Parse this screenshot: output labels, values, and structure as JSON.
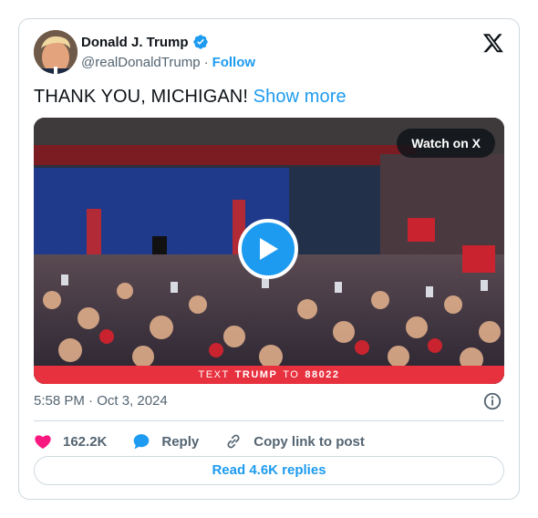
{
  "author": {
    "name": "Donald J. Trump",
    "handle": "@realDonaldTrump",
    "separator": "·",
    "follow_label": "Follow"
  },
  "tweet": {
    "text": "THANK YOU, MICHIGAN!",
    "show_more_label": "Show more"
  },
  "media": {
    "watch_label": "Watch on X",
    "banner_pre": "TEXT",
    "banner_bold": "TRUMP",
    "banner_mid": "TO",
    "banner_num": "88022"
  },
  "timestamp": "5:58 PM · Oct 3, 2024",
  "actions": {
    "likes": "162.2K",
    "reply_label": "Reply",
    "copy_label": "Copy link to post"
  },
  "read_replies_label": "Read 4.6K replies",
  "colors": {
    "accent": "#1d9bf0",
    "like": "#f91880",
    "banner": "#e8313f",
    "muted": "#536471"
  }
}
